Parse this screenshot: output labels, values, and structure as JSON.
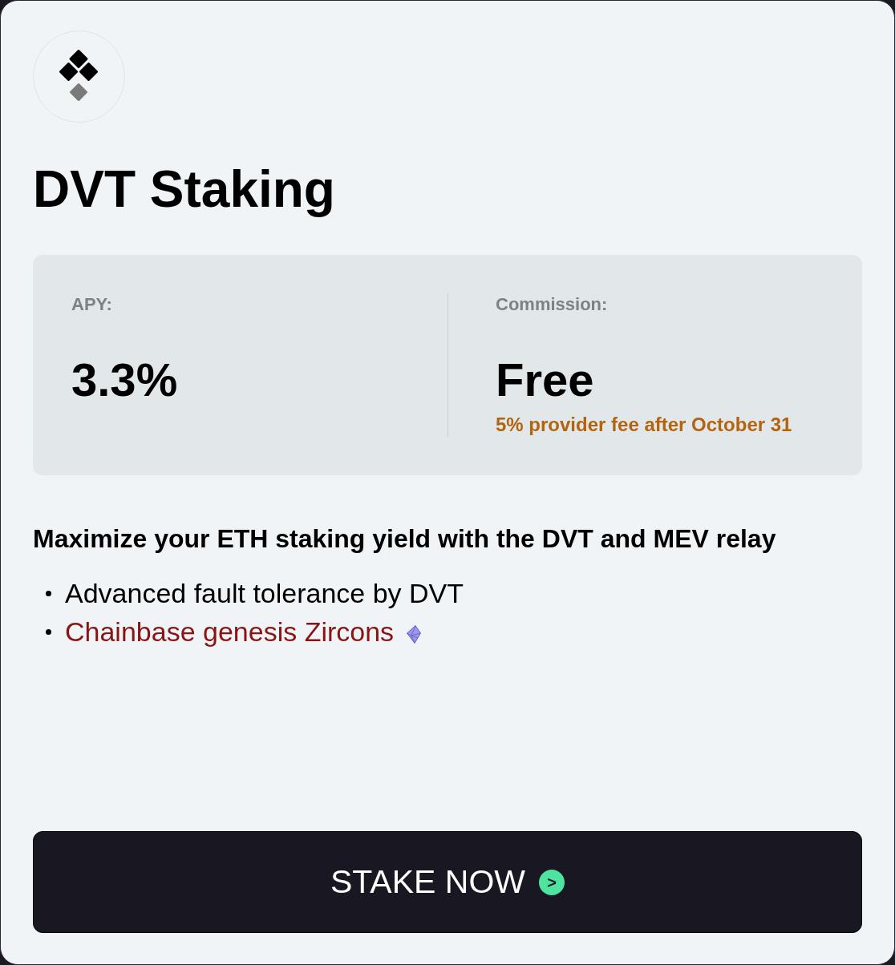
{
  "title": "DVT Staking",
  "stats": [
    {
      "label": "APY:",
      "value": "3.3%"
    },
    {
      "label": "Commission:",
      "value": "Free",
      "note": "5% provider fee after October 31"
    }
  ],
  "description": {
    "heading": "Maximize your ETH staking yield with the DVT and MEV relay",
    "features": [
      {
        "kind": "text",
        "text": "Advanced fault tolerance by DVT"
      },
      {
        "kind": "link",
        "text": "Chainbase genesis Zircons"
      }
    ]
  },
  "button": {
    "label": "STAKE NOW",
    "arrow": ">"
  }
}
